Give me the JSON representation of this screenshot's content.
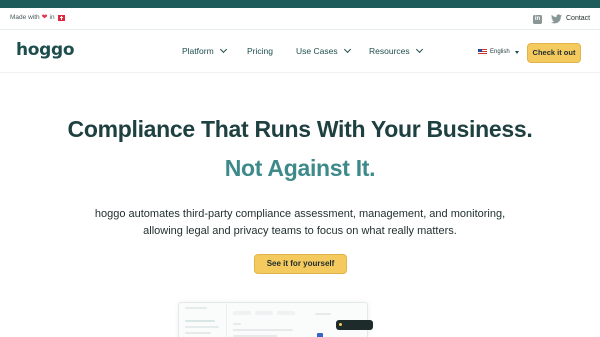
{
  "topbar": {
    "made_with_prefix": "Made with",
    "made_with_in": "in",
    "contact_label": "Contact"
  },
  "nav": {
    "logo": "hoggo",
    "items": [
      {
        "label": "Platform",
        "has_dropdown": true
      },
      {
        "label": "Pricing",
        "has_dropdown": false
      },
      {
        "label": "Use Cases",
        "has_dropdown": true
      },
      {
        "label": "Resources",
        "has_dropdown": true
      }
    ],
    "language": "English",
    "cta_label": "Check it out"
  },
  "hero": {
    "title": "Compliance That Runs With Your Business.",
    "subtitle": "Not Against It.",
    "description": "hoggo automates third-party compliance assessment, management, and monitoring, allowing legal and privacy teams to focus on what really matters.",
    "cta_label": "See it for yourself"
  },
  "colors": {
    "brand_dark": "#1e4d4d",
    "brand_teal": "#3e8a8a",
    "accent_yellow": "#f4c95d",
    "top_strip": "#1e5c5c"
  },
  "icons": [
    "heart-icon",
    "swiss-flag-icon",
    "linkedin-icon",
    "twitter-icon",
    "us-flag-icon",
    "chevron-down-icon"
  ]
}
